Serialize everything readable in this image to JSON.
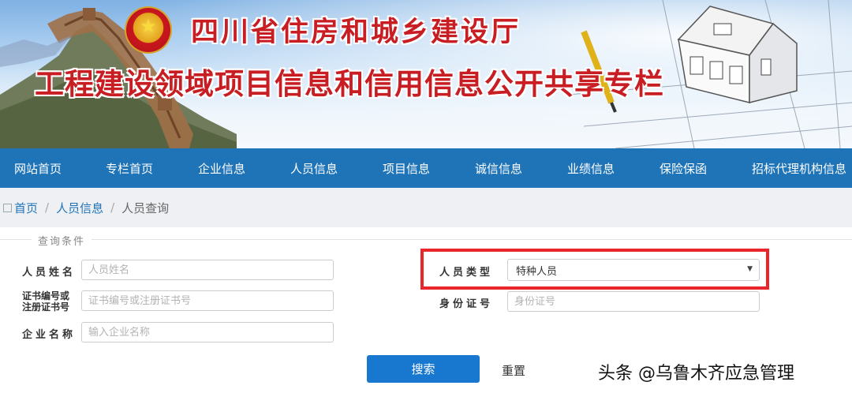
{
  "banner": {
    "title_line1": "四川省住房和城乡建设厅",
    "title_line2": "工程建设领域项目信息和信用信息公开共享专栏"
  },
  "nav": {
    "items": [
      "网站首页",
      "专栏首页",
      "企业信息",
      "人员信息",
      "项目信息",
      "诚信信息",
      "业绩信息",
      "保险保函",
      "招标代理机构信息"
    ]
  },
  "breadcrumb": {
    "items": [
      "首页",
      "人员信息",
      "人员查询"
    ],
    "separator": "/"
  },
  "form": {
    "legend": "查询条件",
    "name_label": "人员姓名",
    "name_placeholder": "人员姓名",
    "cert_label_line1": "证书编号或",
    "cert_label_line2": "注册证书号",
    "cert_placeholder": "证书编号或注册证书号",
    "company_label": "企业名称",
    "company_placeholder": "输入企业名称",
    "type_label": "人员类型",
    "type_selected": "特种人员",
    "id_label": "身份证号",
    "id_placeholder": "身份证号",
    "search_button": "搜索",
    "reset_button": "重置"
  },
  "watermark": "头条 @乌鲁木齐应急管理",
  "colors": {
    "nav_bg": "#1f74b8",
    "title_red": "#c81d22",
    "button_blue": "#1878d0",
    "highlight_red": "#e8262b"
  }
}
